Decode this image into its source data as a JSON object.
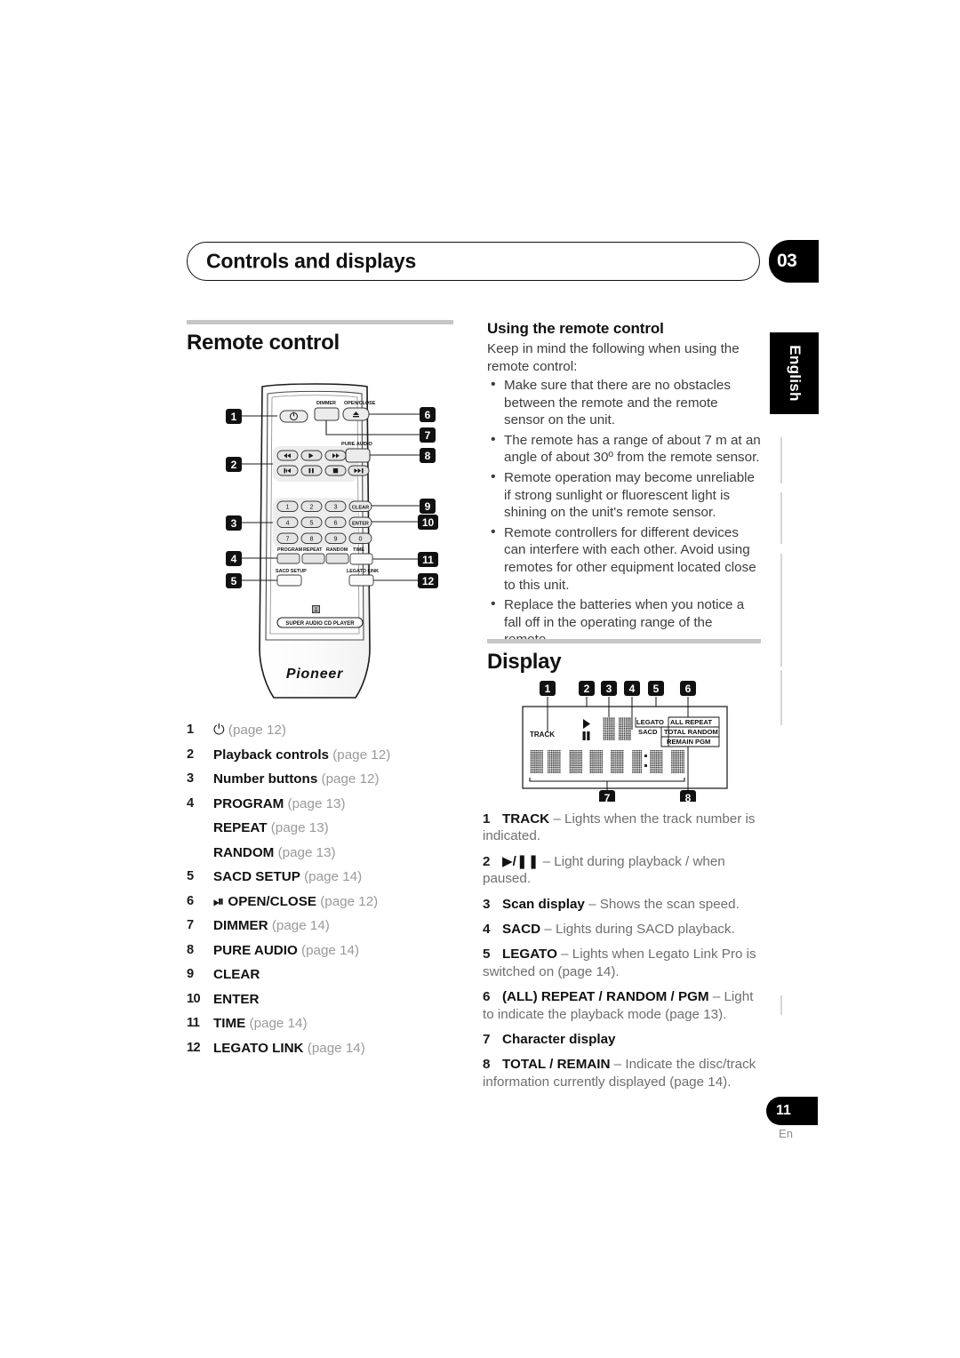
{
  "header": {
    "title": "Controls and displays",
    "chapter": "03"
  },
  "side_tab": {
    "language": "English"
  },
  "footer": {
    "page": "11",
    "lang": "En"
  },
  "left_column": {
    "section_title": "Remote control",
    "remote_diagram": {
      "callouts_left": [
        "1",
        "2",
        "3",
        "4",
        "5"
      ],
      "callouts_right": [
        "6",
        "7",
        "8",
        "9",
        "10",
        "11",
        "12"
      ],
      "button_labels": {
        "dimmer": "DIMMER",
        "open_close": "OPEN/CLOSE",
        "pure_audio": "PURE AUDIO",
        "clear": "CLEAR",
        "enter": "ENTER",
        "program": "PROGRAM",
        "repeat": "REPEAT",
        "random": "RANDOM",
        "time": "TIME",
        "sacd_setup": "SACD SETUP",
        "legato_link": "LEGATO LINK"
      },
      "number_keys": [
        "1",
        "2",
        "3",
        "4",
        "5",
        "6",
        "7",
        "8",
        "9",
        "0"
      ],
      "transport_row1": [
        "rewind",
        "play",
        "fast-forward"
      ],
      "transport_row2": [
        "previous-track",
        "pause",
        "stop",
        "next-track"
      ],
      "model_plate": "SUPER AUDIO CD PLAYER",
      "brand": "Pioneer"
    },
    "key_list": [
      {
        "num": "1",
        "label": "⏻",
        "page": "(page 12)",
        "label_bold": false,
        "indent": false
      },
      {
        "num": "2",
        "label": "Playback controls",
        "page": "(page 12)",
        "label_bold": true,
        "indent": false
      },
      {
        "num": "3",
        "label": "Number buttons",
        "page": "(page 12)",
        "label_bold": true,
        "indent": false
      },
      {
        "num": "4",
        "label": "PROGRAM",
        "page": "(page 13)",
        "label_bold": true,
        "indent": false
      },
      {
        "num": "",
        "label": "REPEAT",
        "page": "(page 13)",
        "label_bold": true,
        "indent": true
      },
      {
        "num": "",
        "label": "RANDOM",
        "page": "(page 13)",
        "label_bold": true,
        "indent": true
      },
      {
        "num": "5",
        "label": "SACD SETUP",
        "page": "(page 14)",
        "label_bold": true,
        "indent": false
      },
      {
        "num": "6",
        "label": "⏏ OPEN/CLOSE",
        "page": "(page 12)",
        "label_bold": true,
        "indent": false
      },
      {
        "num": "7",
        "label": "DIMMER",
        "page": "(page 14)",
        "label_bold": true,
        "indent": false
      },
      {
        "num": "8",
        "label": "PURE AUDIO",
        "page": "(page 14)",
        "label_bold": true,
        "indent": false
      },
      {
        "num": "9",
        "label": "CLEAR",
        "page": "",
        "label_bold": true,
        "indent": false
      },
      {
        "num": "10",
        "label": "ENTER",
        "page": "",
        "label_bold": true,
        "indent": false
      },
      {
        "num": "11",
        "label": "TIME",
        "page": "(page 14)",
        "label_bold": true,
        "indent": false
      },
      {
        "num": "12",
        "label": "LEGATO LINK",
        "page": "(page 14)",
        "label_bold": true,
        "indent": false
      }
    ]
  },
  "right_column": {
    "subsection_title": "Using the remote control",
    "intro": "Keep in mind the following when using the remote control:",
    "bullets": [
      "Make sure that there are no obstacles between the remote and the remote sensor on the unit.",
      "The remote has a range of about 7 m at an angle of about 30º from the remote sensor.",
      "Remote operation may become unreliable if strong sunlight or fluorescent light is shining on the unit's remote sensor.",
      "Remote controllers for different devices can interfere with each other. Avoid using remotes for other equipment located close to this unit.",
      "Replace the batteries when you notice a fall off in the operating range of the remote."
    ],
    "display_section_title": "Display",
    "display_diagram": {
      "callouts_top": [
        "1",
        "2",
        "3",
        "4",
        "5",
        "6"
      ],
      "callouts_bottom": [
        "7",
        "8"
      ],
      "indicators": {
        "track": "TRACK",
        "legato": "LEGATO",
        "sacd": "SACD",
        "all": "ALL",
        "repeat": "REPEAT",
        "total": "TOTAL",
        "random": "RANDOM",
        "remain": "REMAIN",
        "pgm": "PGM"
      }
    },
    "display_list": [
      {
        "num": "1",
        "term": "TRACK",
        "dash": " – ",
        "desc": "Lights when the track number is indicated."
      },
      {
        "num": "2",
        "term": "▶/Ⅱ",
        "dash": " – ",
        "desc": "Light during playback / when paused."
      },
      {
        "num": "3",
        "term": "Scan display",
        "dash": " – ",
        "desc": "Shows the scan speed."
      },
      {
        "num": "4",
        "term": "SACD",
        "dash": " – ",
        "desc": "Lights during SACD playback."
      },
      {
        "num": "5",
        "term": "LEGATO",
        "dash": " – ",
        "desc": "Lights when Legato Link Pro is switched on (page 14)."
      },
      {
        "num": "6",
        "term": "(ALL) REPEAT / RANDOM / PGM",
        "dash": " – ",
        "desc": "Light to indicate the playback mode (page 13)."
      },
      {
        "num": "7",
        "term": "Character display",
        "dash": "",
        "desc": ""
      },
      {
        "num": "8",
        "term": "TOTAL / REMAIN",
        "dash": " – ",
        "desc": "Indicate the disc/track information currently displayed (page 14)."
      }
    ]
  }
}
